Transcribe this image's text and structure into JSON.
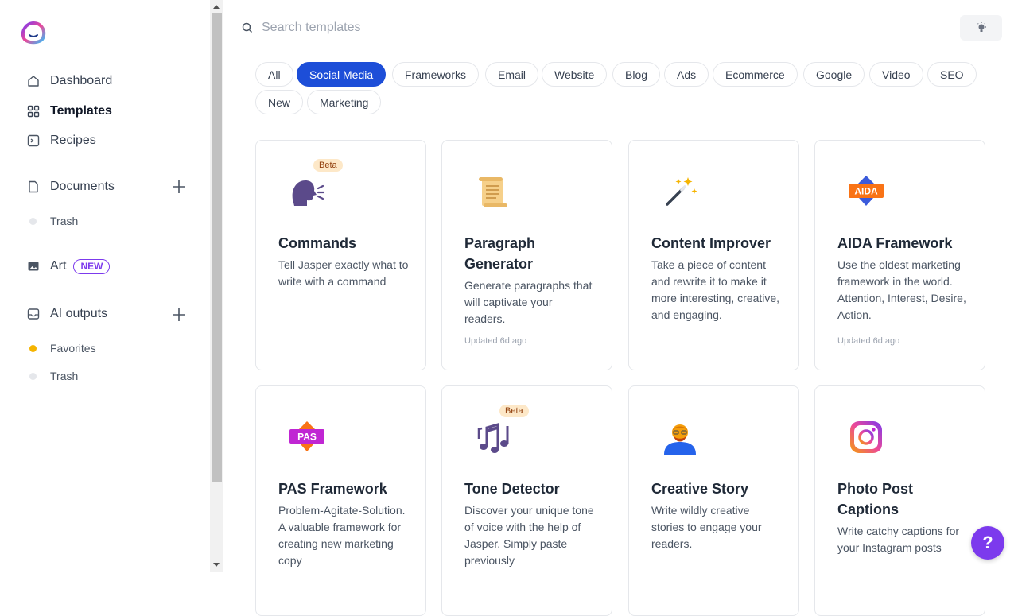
{
  "sidebar": {
    "nav": [
      {
        "label": "Dashboard",
        "icon": "home-icon"
      },
      {
        "label": "Templates",
        "icon": "grid-icon"
      },
      {
        "label": "Recipes",
        "icon": "terminal-icon"
      }
    ],
    "documents": {
      "label": "Documents",
      "trash": "Trash"
    },
    "art": {
      "label": "Art",
      "badge": "NEW"
    },
    "ai_outputs": {
      "label": "AI outputs",
      "favorites": "Favorites",
      "trash": "Trash"
    }
  },
  "header": {
    "search_placeholder": "Search templates"
  },
  "filters": [
    "All",
    "Social Media",
    "Frameworks",
    "Email",
    "Website",
    "Blog",
    "Ads",
    "Ecommerce",
    "Google",
    "Video",
    "SEO",
    "New",
    "Marketing"
  ],
  "active_filter": "Social Media",
  "cards": [
    {
      "title": "Commands",
      "desc": "Tell Jasper exactly what to write with a command",
      "beta": "Beta",
      "updated": "",
      "icon": "speaking-head-icon"
    },
    {
      "title": "Paragraph Generator",
      "desc": "Generate paragraphs that will captivate your readers.",
      "beta": "",
      "updated": "Updated 6d ago",
      "icon": "scroll-icon"
    },
    {
      "title": "Content Improver",
      "desc": "Take a piece of content and rewrite it to make it more interesting, creative, and engaging.",
      "beta": "",
      "updated": "",
      "icon": "magic-wand-icon"
    },
    {
      "title": "AIDA Framework",
      "desc": "Use the oldest marketing framework in the world. Attention, Interest, Desire, Action.",
      "beta": "",
      "updated": "Updated 6d ago",
      "icon": "aida-icon"
    },
    {
      "title": "PAS Framework",
      "desc": "Problem-Agitate-Solution. A valuable framework for creating new marketing copy",
      "beta": "",
      "updated": "",
      "icon": "pas-icon"
    },
    {
      "title": "Tone Detector",
      "desc": "Discover your unique tone of voice with the help of Jasper. Simply paste previously",
      "beta": "Beta",
      "updated": "",
      "icon": "music-notes-icon"
    },
    {
      "title": "Creative Story",
      "desc": "Write wildly creative stories to engage your readers.",
      "beta": "",
      "updated": "",
      "icon": "storyteller-icon"
    },
    {
      "title": "Photo Post Captions",
      "desc": "Write catchy captions for your Instagram posts",
      "beta": "",
      "updated": "",
      "icon": "instagram-icon"
    }
  ],
  "icon_labels": {
    "aida": "AIDA",
    "pas": "PAS"
  },
  "help": "?",
  "colors": {
    "accent": "#1d4ed8",
    "purple": "#7c3aed",
    "beta_bg": "#fde8c8"
  }
}
